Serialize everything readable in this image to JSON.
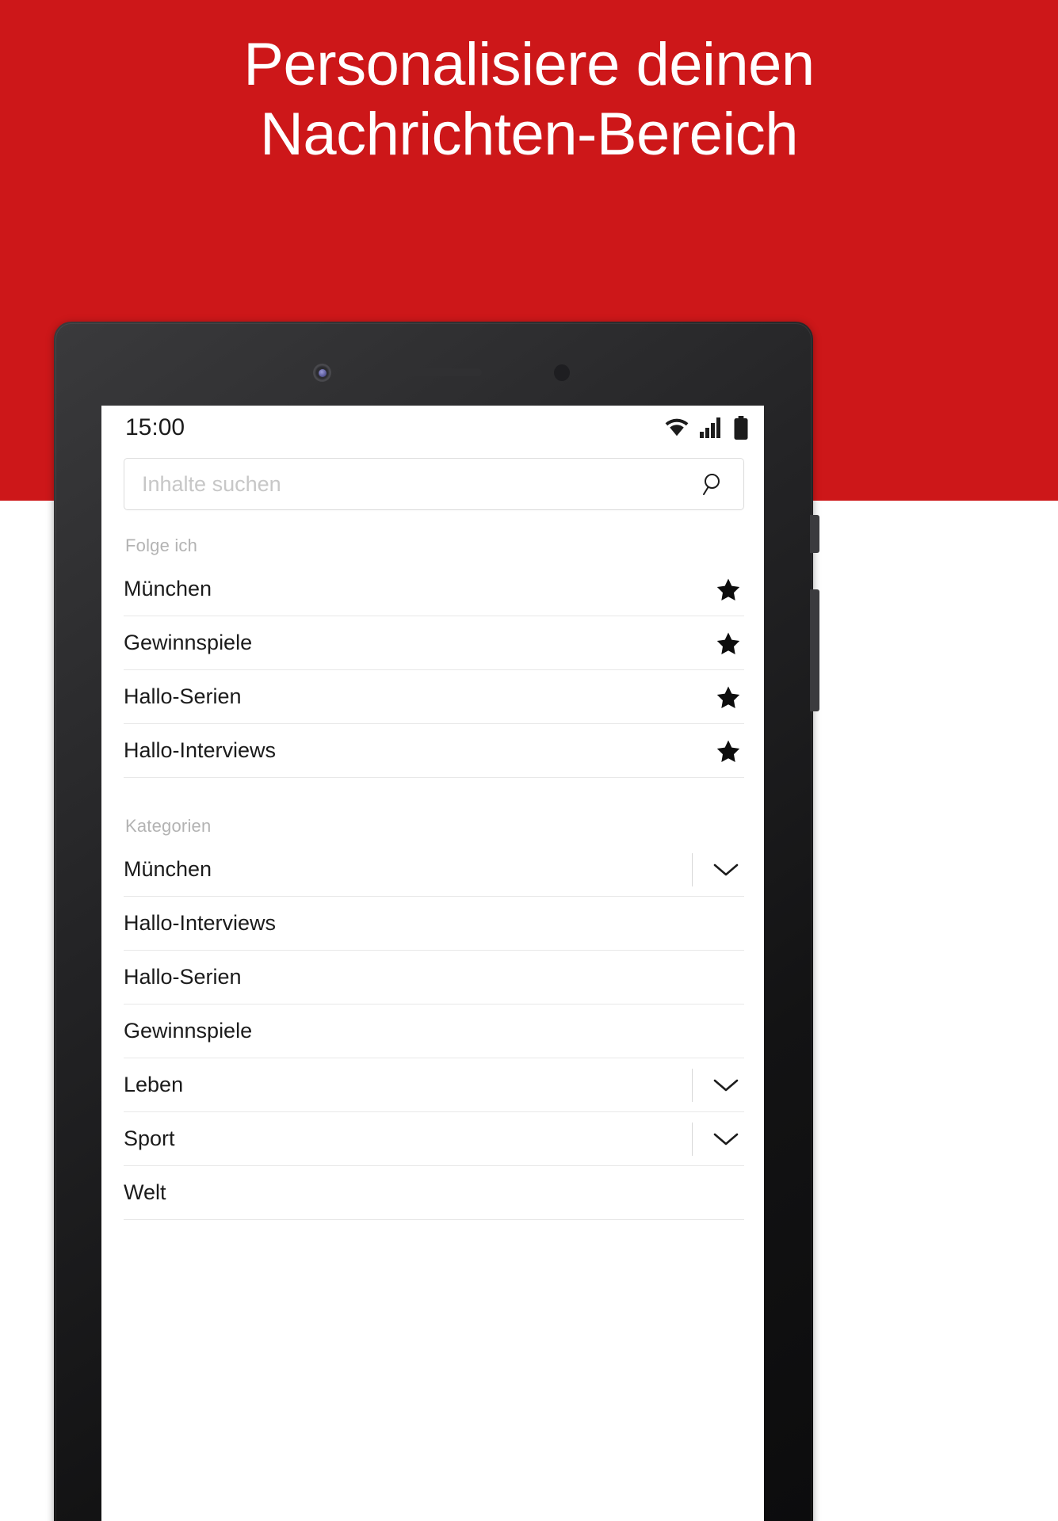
{
  "promo": {
    "headline_line1": "Personalisiere deinen",
    "headline_line2": "Nachrichten-Bereich",
    "background_color": "#cd1719",
    "text_color": "#ffffff"
  },
  "device": {
    "camera_icon": "front-camera",
    "speaker_icon": "earpiece-speaker",
    "sensor_icon": "proximity-sensor"
  },
  "status_bar": {
    "clock": "15:00",
    "icons": [
      "wifi-icon",
      "signal-icon",
      "battery-icon"
    ]
  },
  "search": {
    "placeholder": "Inhalte suchen",
    "value": "",
    "icon": "search-icon"
  },
  "following": {
    "label": "Folge ich",
    "items": [
      {
        "label": "München",
        "trailing": "star-filled-icon"
      },
      {
        "label": "Gewinnspiele",
        "trailing": "star-filled-icon"
      },
      {
        "label": "Hallo-Serien",
        "trailing": "star-filled-icon"
      },
      {
        "label": "Hallo-Interviews",
        "trailing": "star-filled-icon"
      }
    ]
  },
  "categories": {
    "label": "Kategorien",
    "items": [
      {
        "label": "München",
        "trailing": "chevron-down-icon"
      },
      {
        "label": "Hallo-Interviews",
        "trailing": ""
      },
      {
        "label": "Hallo-Serien",
        "trailing": ""
      },
      {
        "label": "Gewinnspiele",
        "trailing": ""
      },
      {
        "label": "Leben",
        "trailing": "chevron-down-icon"
      },
      {
        "label": "Sport",
        "trailing": "chevron-down-icon"
      },
      {
        "label": "Welt",
        "trailing": ""
      }
    ]
  }
}
